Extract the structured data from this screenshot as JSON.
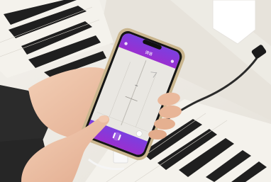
{
  "photo": {
    "phone_app": {
      "header_title": "调音",
      "accent_color": "#8a2be2",
      "screen_bg": "#e9e7e2"
    },
    "colors": {
      "piano_white_keys": "#f4f2ec",
      "piano_black_keys": "#1f1f1f",
      "body": "#dedad2",
      "skin": "#efc3a8",
      "sleeve": "#2b2b2b",
      "cable": "#2a2a2a"
    }
  }
}
